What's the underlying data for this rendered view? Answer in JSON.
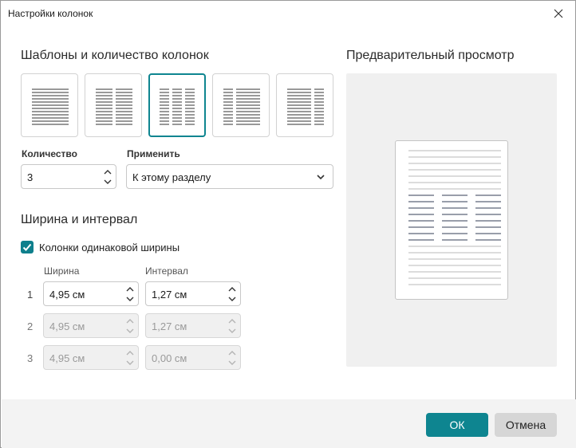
{
  "window": {
    "title": "Настройки колонок"
  },
  "templates_section": {
    "heading": "Шаблоны и количество колонок",
    "selected_index": 2
  },
  "count": {
    "label": "Количество",
    "value": "3"
  },
  "apply": {
    "label": "Применить",
    "value": "К этому разделу"
  },
  "width_section": {
    "heading": "Ширина и интервал",
    "equal_width_label": "Колонки одинаковой ширины",
    "equal_width_checked": true,
    "width_header": "Ширина",
    "spacing_header": "Интервал",
    "rows": [
      {
        "num": "1",
        "width": "4,95 см",
        "spacing": "1,27 см",
        "enabled": true
      },
      {
        "num": "2",
        "width": "4,95 см",
        "spacing": "1,27 см",
        "enabled": false
      },
      {
        "num": "3",
        "width": "4,95 см",
        "spacing": "0,00 см",
        "enabled": false
      }
    ]
  },
  "preview": {
    "heading": "Предварительный просмотр"
  },
  "buttons": {
    "ok": "ОК",
    "cancel": "Отмена"
  },
  "colors": {
    "accent": "#0e8590",
    "disabled_bg": "#f0f0f0",
    "footer_bg": "#f3f3f3"
  }
}
